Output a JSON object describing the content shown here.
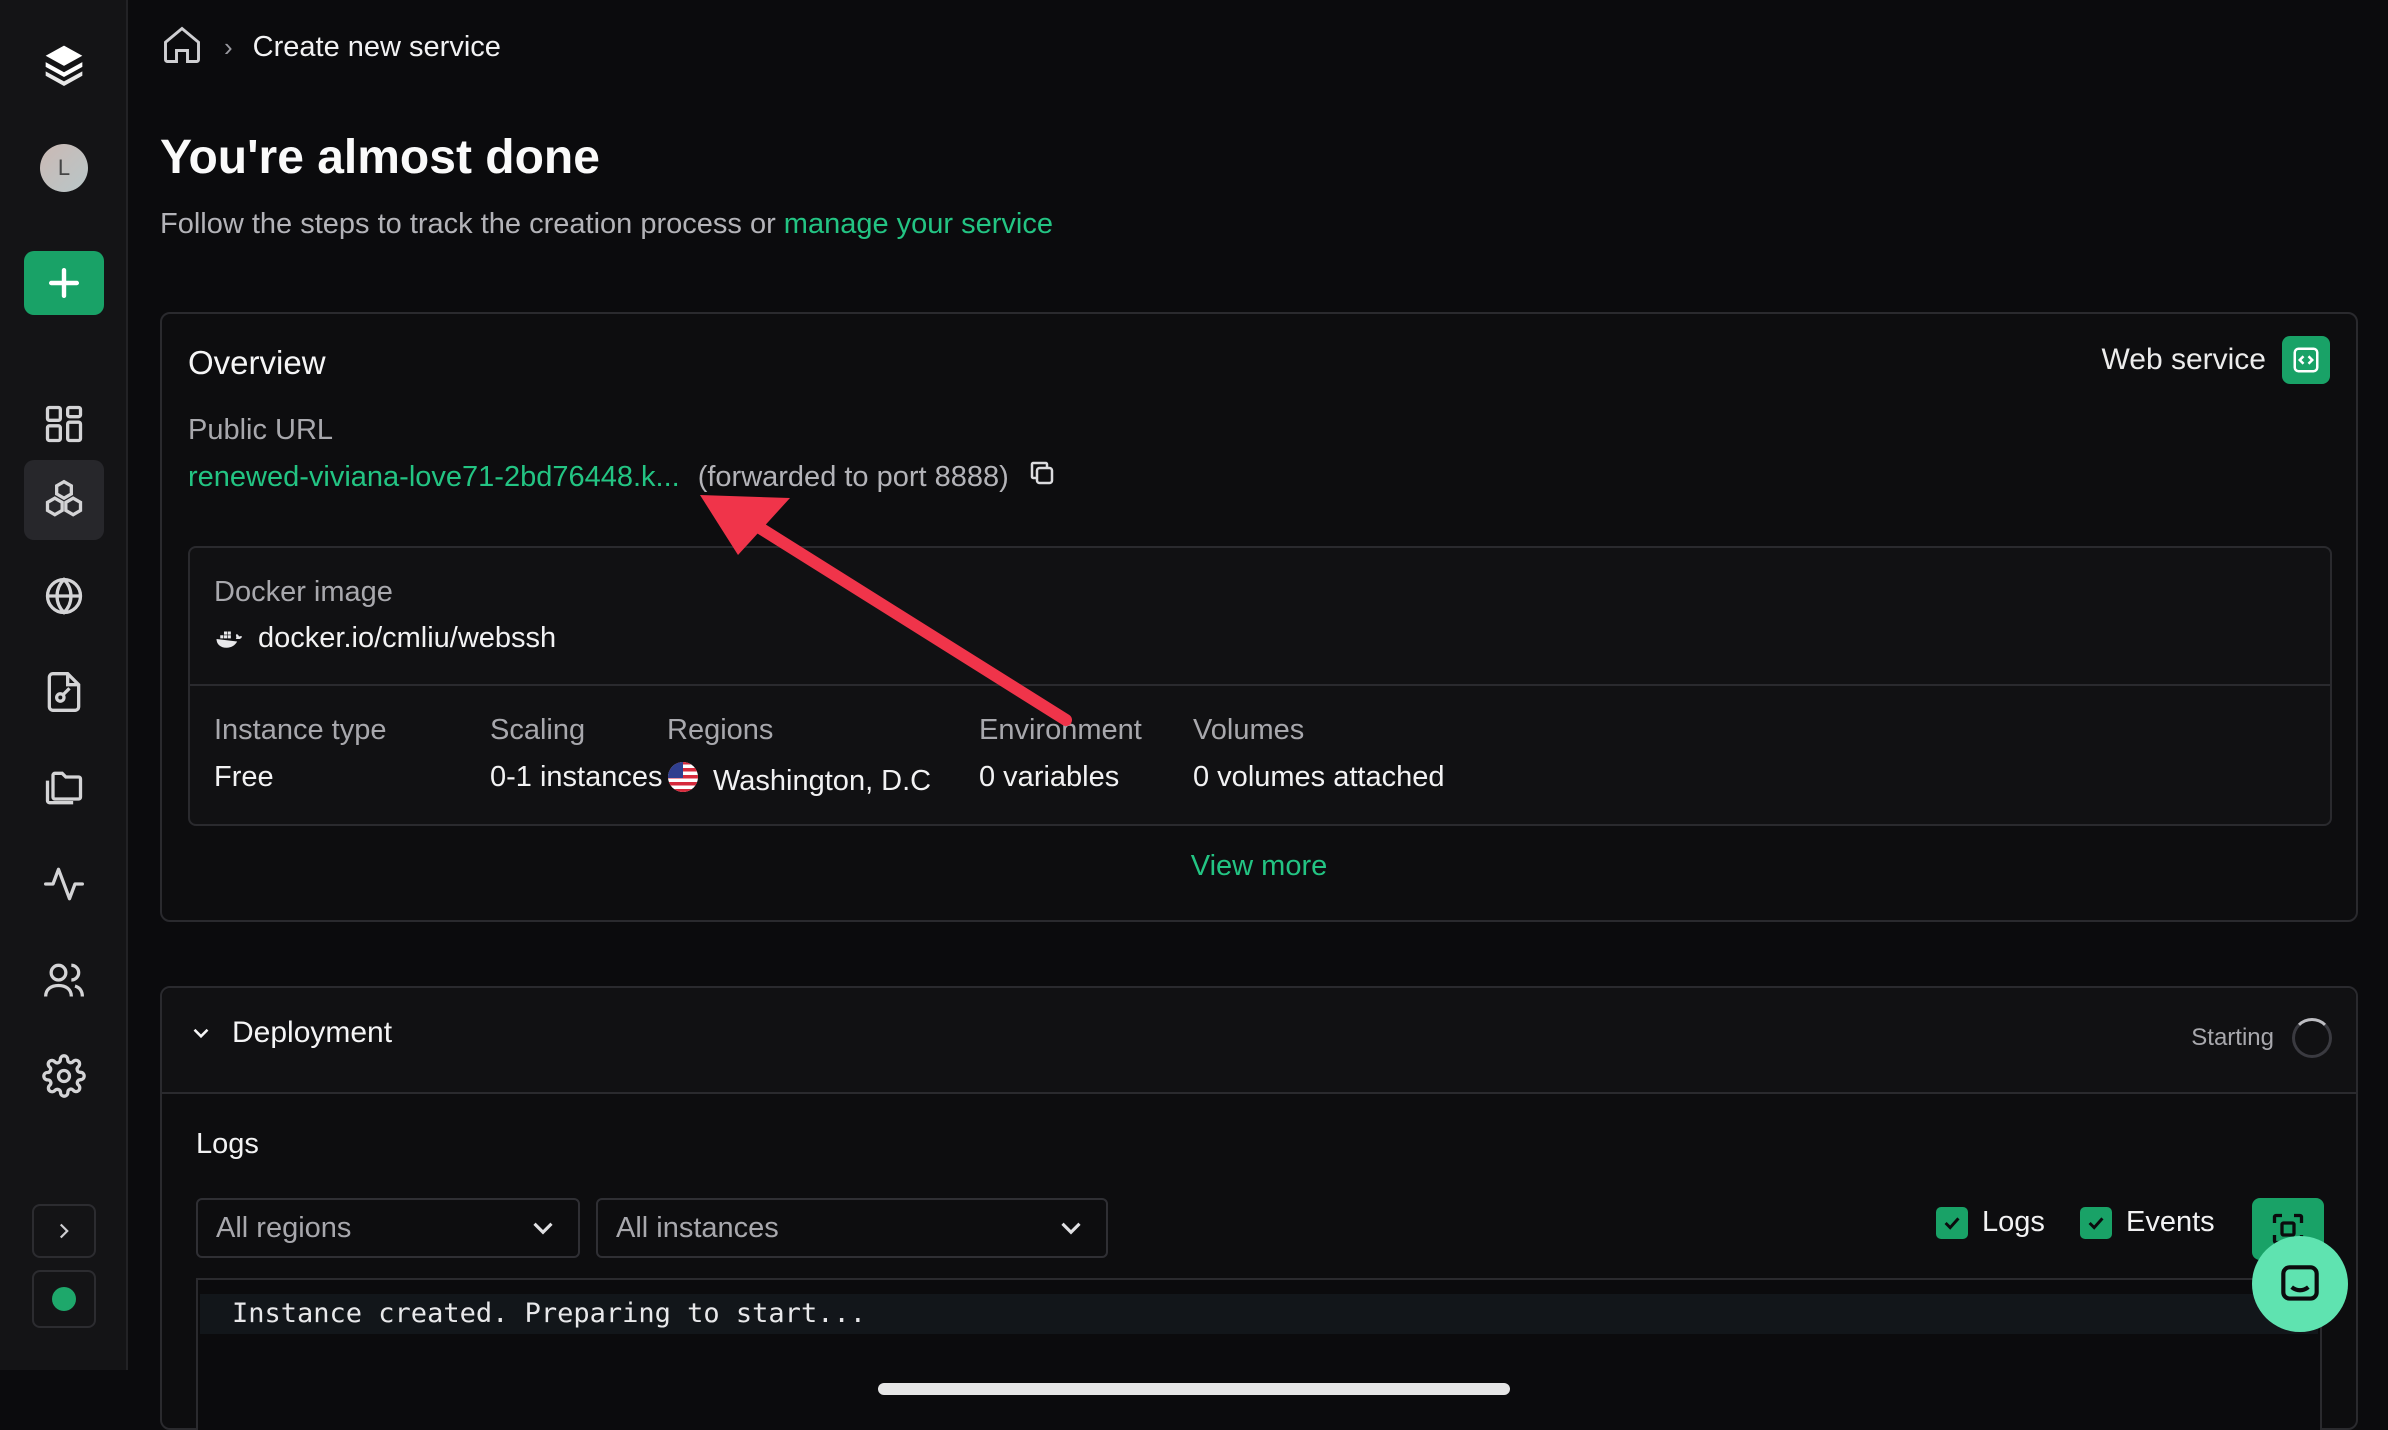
{
  "breadcrumb": {
    "current": "Create new service"
  },
  "header": {
    "title": "You're almost done",
    "subtitle_prefix": "Follow the steps to track the creation process or",
    "subtitle_link": "manage your service"
  },
  "sidebar": {
    "avatar_initial": "L"
  },
  "overview": {
    "title": "Overview",
    "service_type": "Web service",
    "public_url_label": "Public URL",
    "public_url": "renewed-viviana-love71-2bd76448.k...",
    "forward_note": "(forwarded to port 8888)",
    "docker_label": "Docker image",
    "docker_image": "docker.io/cmliu/webssh",
    "meta": [
      {
        "label": "Instance type",
        "value": "Free"
      },
      {
        "label": "Scaling",
        "value": "0-1 instances"
      },
      {
        "label": "Regions",
        "value": "Washington, D.C"
      },
      {
        "label": "Environment",
        "value": "0 variables"
      },
      {
        "label": "Volumes",
        "value": "0 volumes attached"
      }
    ],
    "view_more": "View more"
  },
  "deployment": {
    "title": "Deployment",
    "status": "Starting",
    "logs_label": "Logs",
    "region_select": "All regions",
    "instance_select": "All instances",
    "check_logs": "Logs",
    "check_events": "Events",
    "log_lines": [
      "Instance created. Preparing to start..."
    ]
  },
  "colors": {
    "accent": "#19a267",
    "link": "#23c483",
    "annotation": "#f0344a"
  }
}
